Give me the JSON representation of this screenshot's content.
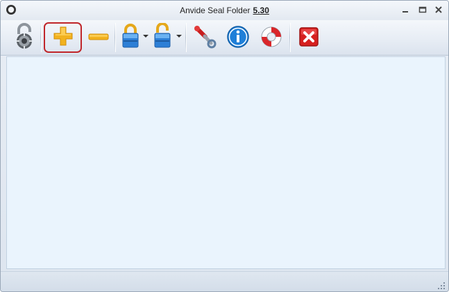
{
  "window": {
    "title": "Anvide Seal Folder",
    "version": "5.30"
  },
  "toolbar": {
    "items": [
      {
        "id": "lock-all",
        "icon": "padlock-open-icon",
        "tooltip": ""
      },
      {
        "id": "add-folder",
        "icon": "plus-icon",
        "highlighted": true
      },
      {
        "id": "remove-folder",
        "icon": "minus-icon"
      },
      {
        "id": "close-access",
        "icon": "closed-lock-icon",
        "dropdown": true
      },
      {
        "id": "open-access",
        "icon": "open-lock-icon",
        "dropdown": true
      },
      {
        "id": "settings",
        "icon": "wrench-icon"
      },
      {
        "id": "about",
        "icon": "info-icon"
      },
      {
        "id": "help",
        "icon": "lifebuoy-icon"
      },
      {
        "id": "exit",
        "icon": "close-x-icon"
      }
    ]
  },
  "colors": {
    "highlight": "#c0262a",
    "list_background": "#eaf4fd"
  }
}
